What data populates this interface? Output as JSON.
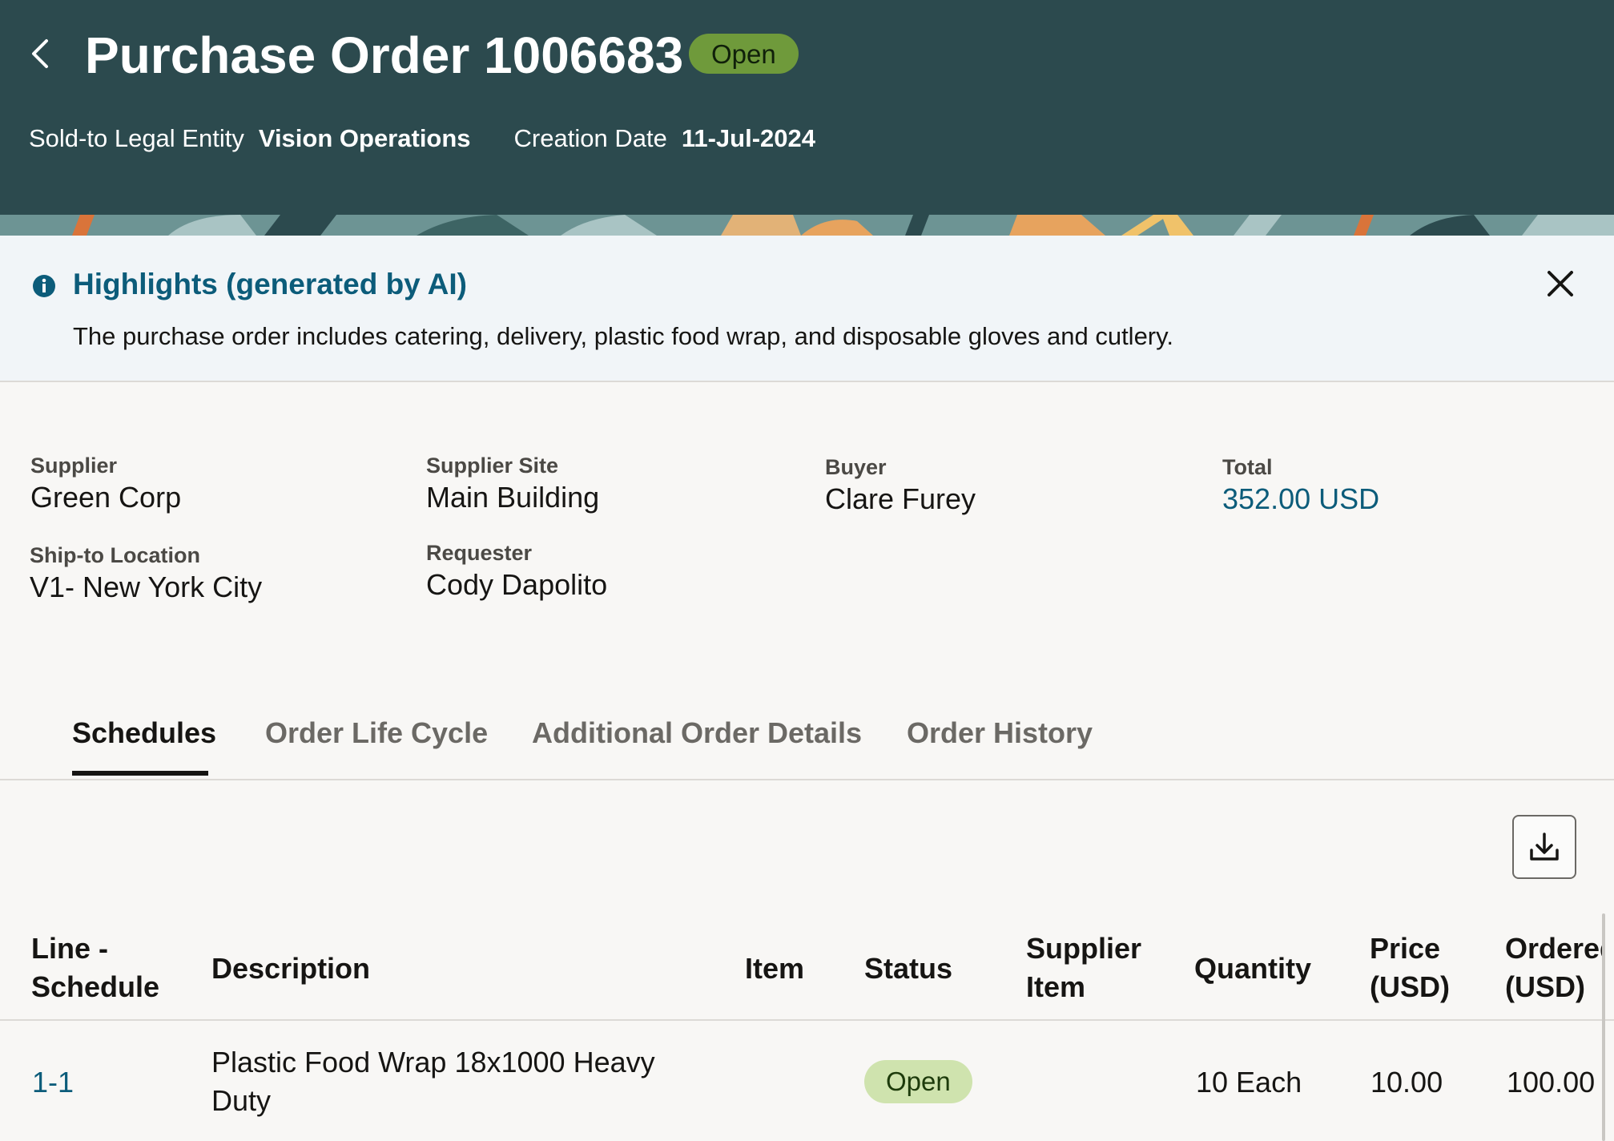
{
  "header": {
    "title": "Purchase Order 1006683",
    "status": "Open",
    "meta": [
      {
        "label": "Sold-to Legal Entity",
        "value": "Vision Operations"
      },
      {
        "label": "Creation Date",
        "value": "11-Jul-2024"
      }
    ]
  },
  "highlights": {
    "title": "Highlights (generated by AI)",
    "text": "The purchase order includes catering, delivery, plastic food wrap, and disposable gloves and cutlery."
  },
  "summary": {
    "supplier": {
      "label": "Supplier",
      "value": "Green Corp"
    },
    "supplier_site": {
      "label": "Supplier Site",
      "value": "Main Building"
    },
    "buyer": {
      "label": "Buyer",
      "value": "Clare Furey"
    },
    "total": {
      "label": "Total",
      "value": "352.00 USD"
    },
    "ship_to": {
      "label": "Ship-to Location",
      "value": "V1- New York City"
    },
    "requester": {
      "label": "Requester",
      "value": "Cody Dapolito"
    }
  },
  "tabs": [
    "Schedules",
    "Order Life Cycle",
    "Additional Order Details",
    "Order History"
  ],
  "table": {
    "headers": {
      "line_schedule": [
        "Line -",
        "Schedule"
      ],
      "description": "Description",
      "item": "Item",
      "status": "Status",
      "supplier_item": [
        "Supplier",
        "Item"
      ],
      "quantity": "Quantity",
      "price": [
        "Price",
        "(USD)"
      ],
      "ordered": [
        "Ordered",
        "(USD)"
      ]
    },
    "rows": [
      {
        "line_schedule": "1-1",
        "description": [
          "Plastic Food Wrap 18x1000 Heavy",
          "Duty"
        ],
        "item": "",
        "status": "Open",
        "supplier_item": "",
        "quantity": "10 Each",
        "price": "10.00",
        "ordered": "100.00"
      }
    ]
  },
  "colors": {
    "header_bg": "#2c4a4e",
    "status_open_header": "#6f9a3b",
    "status_open_row": "#cfe3ae",
    "link": "#0c5c7a",
    "highlights_bg": "#f1f5f8"
  },
  "icons": [
    "chevron-left-icon",
    "info-icon",
    "close-icon",
    "download-icon"
  ]
}
